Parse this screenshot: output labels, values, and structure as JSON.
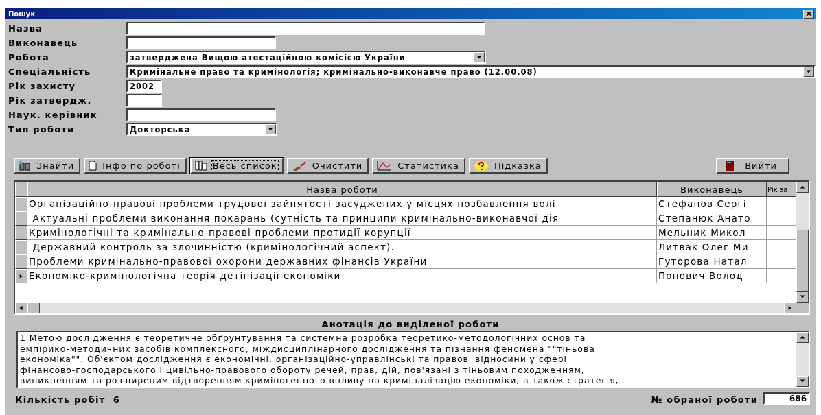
{
  "window": {
    "title": "Пошук"
  },
  "form": [
    {
      "label": "Назва",
      "kind": "text"
    },
    {
      "label": "Виконавець",
      "kind": "text"
    },
    {
      "label": "Робота",
      "kind": "select",
      "value": "затверджена Вищою атестаційною комісією України"
    },
    {
      "label": "Спеціальність",
      "kind": "select",
      "value": "Кримінальне право та кримінологія; кримінально-виконавче право (12.00.08)"
    },
    {
      "label": "Рік захисту",
      "kind": "text",
      "value": "2002"
    },
    {
      "label": "Рік затвердж.",
      "kind": "text"
    },
    {
      "label": "Наук. керівник",
      "kind": "text"
    },
    {
      "label": "Тип роботи",
      "kind": "select",
      "value": "Докторська"
    }
  ],
  "buttons": [
    {
      "label": "Знайти",
      "focused": false
    },
    {
      "label": "Інфо по роботі",
      "focused": false
    },
    {
      "label": "Весь список",
      "focused": true
    },
    {
      "label": "Очистити",
      "focused": false
    },
    {
      "label": "Статистика",
      "focused": false
    },
    {
      "label": "Підказка",
      "focused": false
    },
    {
      "label": "Вийти",
      "focused": false
    }
  ],
  "table": {
    "columns": [
      "Назва роботи",
      "Виконавець",
      "Рік за"
    ],
    "rows": [
      {
        "cells": [
          "Організаційно-правові проблеми трудової зайнятості засуджених у місцях позбавлення волі",
          "Стефанов Сергі"
        ],
        "selected": false
      },
      {
        "cells": [
          " Актуальні проблеми виконання покарань (сутність та принципи кримінально-виконавчої дія",
          "Степанюк Анато"
        ],
        "selected": false
      },
      {
        "cells": [
          "Кримінологічні та кримінально-правові проблеми протидії корупції",
          "Мельник Микол"
        ],
        "selected": false
      },
      {
        "cells": [
          " Державний контроль за злочинністю (кримінологічний аспект).",
          "Литвак Олег Ми"
        ],
        "selected": false
      },
      {
        "cells": [
          "Проблеми кримінально-правової охорони державних фінансів України",
          "Гуторова Натал"
        ],
        "selected": false
      },
      {
        "cells": [
          "Економіко-кримінологічна теорія детінізації економіки",
          "Попович Волод"
        ],
        "selected": true
      }
    ]
  },
  "annotation": {
    "title": "Анотація до виділеної роботи",
    "lines": [
      "1 Метою дослідження є теоретичне обґрунтування та системна розробка теоретико-методологічних основ та",
      "емпірико-методичних засобів комплексного, міждисциплінарного дослідження та пізнання феномена \"\"тіньова",
      "економіка\"\". Об'єктом дослідження є економічні, організаційно-управлінські та правові відносини у сфері",
      "фінансово-господарського і цивільно-правового обороту речей, прав, дій, пов'язані з тіньовим походженням,",
      "виникненням та розширеним відтворенням криміногенного впливу на криміналізацію економіки, а також стратегія,"
    ]
  },
  "footer": {
    "count": "Кількість робіт  6",
    "selected_label": "№ обраної роботи",
    "selected_value": "686"
  }
}
